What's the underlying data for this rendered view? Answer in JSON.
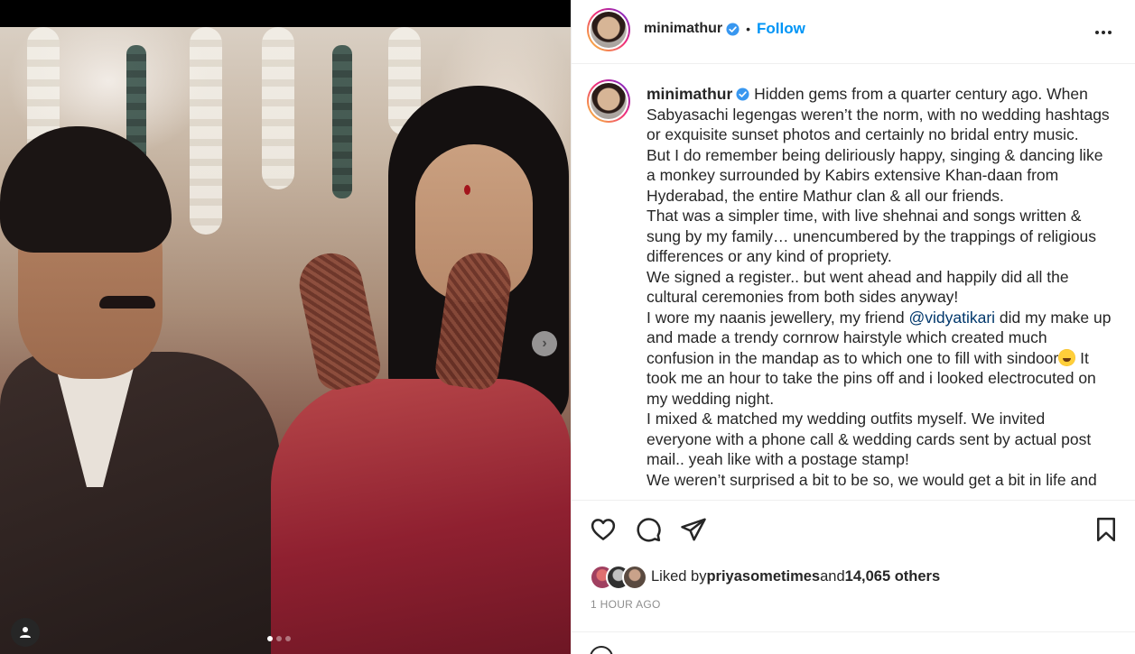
{
  "post": {
    "username": "minimathur",
    "verified": true,
    "separator": "•",
    "follow_label": "Follow",
    "carousel": {
      "total": 3,
      "active": 1
    }
  },
  "caption": {
    "username": "minimathur",
    "paragraphs": [
      "Hidden gems from a quarter century ago. When Sabyasachi legengas weren’t the norm, with no wedding hashtags or exquisite sunset photos and certainly no bridal entry music.",
      "But I do remember being deliriously happy, singing & dancing like a monkey surrounded by Kabirs extensive Khan-daan from Hyderabad, the entire Mathur clan & all our friends.",
      "That was a simpler time, with live shehnai and songs written & sung by my family… unencumbered by the trappings of religious differences or any kind of propriety.",
      "We signed a register.. but went ahead and happily did all the cultural ceremonies from both sides anyway!"
    ],
    "p5_before": "I wore my naanis jewellery, my friend ",
    "p5_mention": "@vidyatikari",
    "p5_middle": " did my make up and made a trendy cornrow hairstyle which created much confusion in the mandap as to which one to fill with sindoor",
    "p5_after": " It took me an hour to take the pins off and i looked electrocuted on my wedding night.",
    "p6": "I mixed & matched my wedding outfits myself. We invited everyone with a phone call & wedding cards sent by actual post mail.. yeah like with a postage stamp!",
    "p7": "We weren’t surprised a bit to be so, we would get a bit in life and"
  },
  "likes": {
    "prefix": "Liked by ",
    "user": "priyasometimes",
    "middle": " and ",
    "count_text": "14,065 others"
  },
  "timestamp": "1 HOUR AGO",
  "colors": {
    "accent": "#0095f6",
    "verified": "#3897f0",
    "text": "#262626",
    "muted": "#8e8e8e",
    "mention": "#00376b"
  },
  "icons": [
    "heart-icon",
    "comment-icon",
    "share-icon",
    "bookmark-icon",
    "more-options-icon",
    "verified-icon",
    "user-tag-icon",
    "chevron-right-icon"
  ]
}
